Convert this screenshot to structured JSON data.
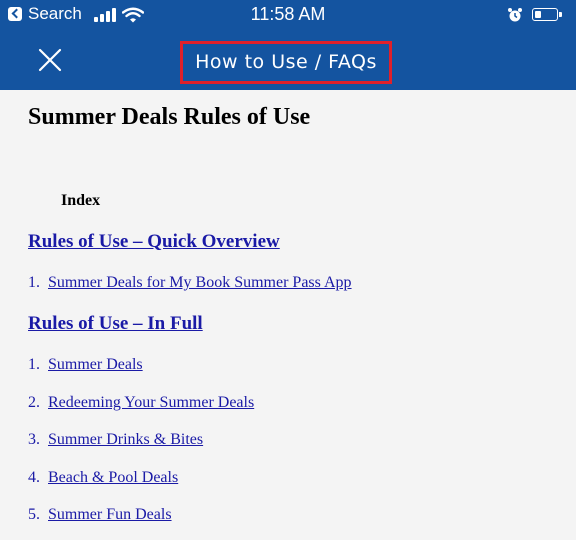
{
  "status_bar": {
    "back_label": "Search",
    "time": "11:58 AM"
  },
  "nav": {
    "title": "How to Use / FAQs"
  },
  "page": {
    "title": "Summer Deals Rules of Use",
    "index_label": "Index",
    "sections": [
      {
        "heading": "Rules of Use – Quick Overview",
        "items": [
          {
            "num": "1.",
            "label": "Summer Deals for My Book Summer Pass App"
          }
        ]
      },
      {
        "heading": "Rules of Use – In Full",
        "items": [
          {
            "num": "1.",
            "label": "Summer Deals"
          },
          {
            "num": "2.",
            "label": "Redeeming Your Summer Deals"
          },
          {
            "num": "3.",
            "label": "Summer Drinks & Bites"
          },
          {
            "num": "4.",
            "label": "Beach & Pool Deals"
          },
          {
            "num": "5.",
            "label": "Summer Fun Deals"
          }
        ]
      }
    ]
  },
  "colors": {
    "nav_bar": "#1454a0",
    "highlight_border": "#e0202a",
    "link": "#1a1aa6",
    "background": "#f4f4f4"
  }
}
